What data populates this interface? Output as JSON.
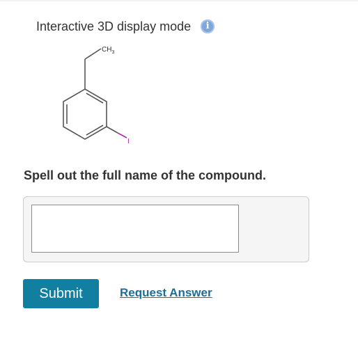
{
  "display_mode": {
    "label": "Interactive 3D display mode",
    "info_icon": "info-icon",
    "info_glyph": "i"
  },
  "molecule": {
    "methyl_label": "CH",
    "methyl_subscript": "3",
    "substituent_label": "I",
    "bond_color": "#555555",
    "iodine_color": "#b026b0"
  },
  "question": {
    "text": "Spell out the full name of the compound."
  },
  "answer": {
    "value": "",
    "placeholder": ""
  },
  "actions": {
    "submit_label": "Submit",
    "request_answer_label": "Request Answer"
  },
  "colors": {
    "submit_bg": "#127fa1",
    "link": "#1a6e98",
    "info_icon": "#7fa6dc"
  }
}
